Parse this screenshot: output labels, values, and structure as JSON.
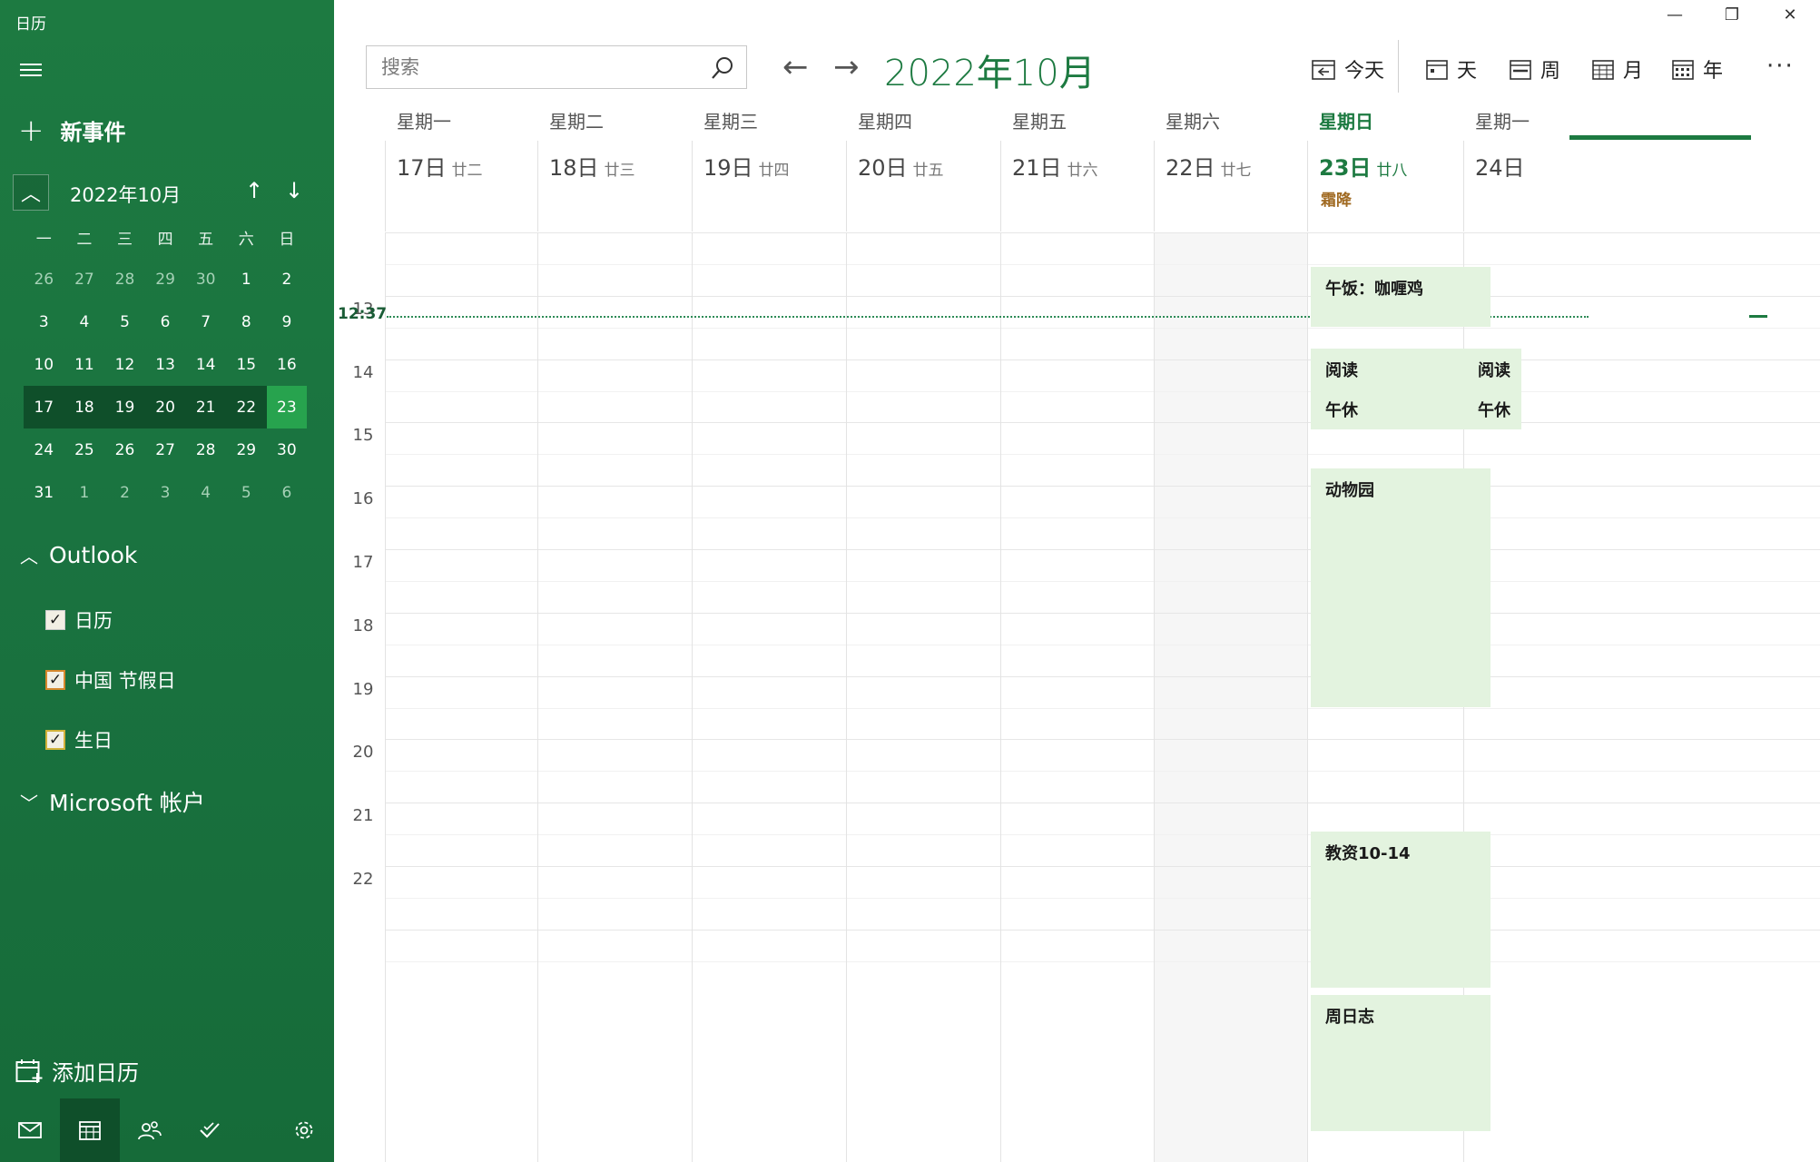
{
  "app": {
    "title": "日历"
  },
  "sidebar": {
    "new_event": "新事件",
    "mini_calendar": {
      "month_title": "2022年10月",
      "weekdays": [
        "一",
        "二",
        "三",
        "四",
        "五",
        "六",
        "日"
      ],
      "weeks": [
        [
          "26",
          "27",
          "28",
          "29",
          "30",
          "1",
          "2"
        ],
        [
          "3",
          "4",
          "5",
          "6",
          "7",
          "8",
          "9"
        ],
        [
          "10",
          "11",
          "12",
          "13",
          "14",
          "15",
          "16"
        ],
        [
          "17",
          "18",
          "19",
          "20",
          "21",
          "22",
          "23"
        ],
        [
          "24",
          "25",
          "26",
          "27",
          "28",
          "29",
          "30"
        ],
        [
          "31",
          "1",
          "2",
          "3",
          "4",
          "5",
          "6"
        ]
      ],
      "selected_week": 3,
      "today_col": 6
    },
    "accounts": [
      {
        "name": "Outlook",
        "expanded": true,
        "calendars": [
          {
            "label": "日历",
            "checked": true,
            "color": "#f2efe4"
          },
          {
            "label": "中国 节假日",
            "checked": true,
            "color": "#d6882d"
          },
          {
            "label": "生日",
            "checked": true,
            "color": "#d1b23a"
          }
        ]
      },
      {
        "name": "Microsoft 帐户",
        "expanded": false,
        "calendars": []
      }
    ],
    "add_calendar": "添加日历",
    "bottom_icons": [
      "mail-icon",
      "calendar-icon",
      "people-icon",
      "todo-icon",
      "settings-icon"
    ],
    "active_bottom": "calendar-icon"
  },
  "toolbar": {
    "search_placeholder": "搜索",
    "month_title": "2022年10月",
    "today": "今天",
    "views": [
      "天",
      "周",
      "月",
      "年"
    ],
    "more": "···"
  },
  "window_controls": {
    "minimize": "—",
    "restore": "❐",
    "close": "✕"
  },
  "week": {
    "days": [
      {
        "name": "星期一",
        "date": "17日",
        "lunar": "廿二"
      },
      {
        "name": "星期二",
        "date": "18日",
        "lunar": "廿三"
      },
      {
        "name": "星期三",
        "date": "19日",
        "lunar": "廿四"
      },
      {
        "name": "星期四",
        "date": "20日",
        "lunar": "廿五"
      },
      {
        "name": "星期五",
        "date": "21日",
        "lunar": "廿六"
      },
      {
        "name": "星期六",
        "date": "22日",
        "lunar": "廿七"
      },
      {
        "name": "星期日",
        "date": "23日",
        "lunar": "廿八",
        "holiday": "霜降",
        "today": true
      },
      {
        "name": "星期一",
        "date": "24日",
        "lunar": ""
      }
    ],
    "current_time": "12:37",
    "hours": [
      "13",
      "14",
      "15",
      "16",
      "17",
      "18",
      "19",
      "20",
      "21",
      "22"
    ]
  },
  "events": [
    {
      "title": "午饭：咖喱鸡",
      "day": 6
    },
    {
      "title": "阅读",
      "day": 6
    },
    {
      "title": "午休",
      "day": 6
    },
    {
      "title": "动物园",
      "day": 6
    },
    {
      "title": "教资10-14",
      "day": 6
    },
    {
      "title": "周日志",
      "day": 6
    },
    {
      "title": "阅读",
      "day": 7
    },
    {
      "title": "午休",
      "day": 7
    }
  ],
  "colors": {
    "accent": "#1d7a41",
    "sidebar": "#1a7340",
    "event_bg": "#e3f3df"
  }
}
